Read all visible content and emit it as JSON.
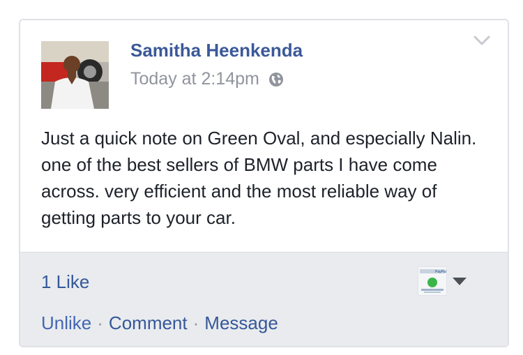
{
  "post": {
    "author_name": "Samitha Heenkenda",
    "timestamp": "Today at 2:14pm",
    "privacy_icon": "globe-icon",
    "text": "Just a quick note on Green Oval, and especially Nalin. one of the best sellers of BMW parts I have come across. very efficient and the most reliable way of getting parts to your car."
  },
  "footer": {
    "likes": "1 Like",
    "unlike_label": "Unlike",
    "separator": "·",
    "comment_label": "Comment",
    "message_label": "Message"
  },
  "colors": {
    "link_blue": "#3b5998",
    "muted_gray": "#90949c",
    "footer_bg": "#e9ebee"
  }
}
